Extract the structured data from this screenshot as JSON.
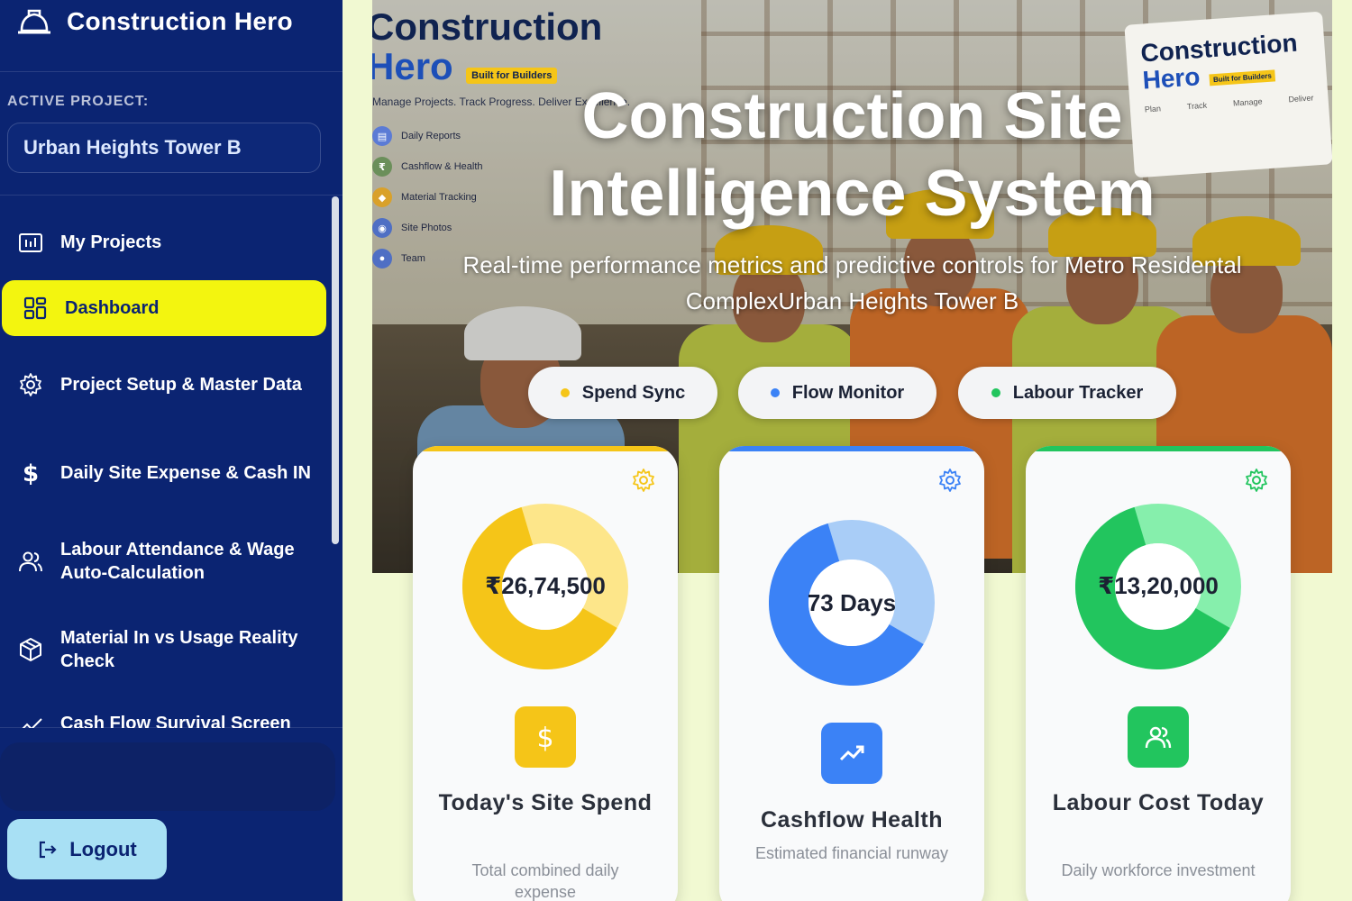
{
  "app": {
    "title": "Construction Hero"
  },
  "project": {
    "label": "ACTIVE PROJECT:",
    "name": "Urban Heights Tower B"
  },
  "sidebar": {
    "items": [
      {
        "label": "My Projects",
        "icon": "projects-icon"
      },
      {
        "label": "Dashboard",
        "icon": "dashboard-icon",
        "active": true
      },
      {
        "label": "Project Setup & Master Data",
        "icon": "gear-icon"
      },
      {
        "label": "Daily Site Expense & Cash IN",
        "icon": "dollar-icon"
      },
      {
        "label": "Labour Attendance & Wage Auto-Calculation",
        "icon": "users-icon"
      },
      {
        "label": "Material In vs Usage Reality Check",
        "icon": "box-icon"
      },
      {
        "label": "Cash Flow Survival Screen",
        "icon": "trend-icon"
      }
    ],
    "logout": "Logout"
  },
  "hero": {
    "title_line1": "Construction Site",
    "title_line2": "Intelligence System",
    "subtitle": "Real-time performance metrics and predictive controls for Metro Residental ComplexUrban Heights Tower B",
    "pills": [
      {
        "label": "Spend Sync",
        "color": "#f5c518"
      },
      {
        "label": "Flow Monitor",
        "color": "#3b82f6"
      },
      {
        "label": "Labour Tracker",
        "color": "#22c55e"
      }
    ],
    "poster_left": {
      "title1": "Construction",
      "title2": "Hero",
      "badge": "Built for Builders",
      "tagline": "Manage Projects. Track Progress. Deliver Excellence.",
      "items": [
        "Daily Reports",
        "Cashflow & Health",
        "Material Tracking",
        "Site Photos",
        "Team"
      ]
    },
    "poster_right": {
      "title1": "Construction",
      "title2": "Hero",
      "badge": "Built for Builders",
      "icons": [
        "Plan",
        "Track",
        "Manage",
        "Deliver"
      ]
    }
  },
  "cards": [
    {
      "value": "₹26,74,500",
      "title": "Today's Site Spend",
      "description": "Total combined daily expense",
      "color": "#f5c518",
      "light": "#fde68a",
      "fill": 0.62,
      "icon": "dollar-icon"
    },
    {
      "value": "73 Days",
      "title": "Cashflow Health",
      "description": "Estimated financial runway",
      "color": "#3b82f6",
      "light": "#a9cdf7",
      "fill": 0.62,
      "icon": "trending-up-icon"
    },
    {
      "value": "₹13,20,000",
      "title": "Labour Cost Today",
      "description": "Daily workforce investment",
      "color": "#22c55e",
      "light": "#86efac",
      "fill": 0.62,
      "icon": "users-icon"
    }
  ]
}
